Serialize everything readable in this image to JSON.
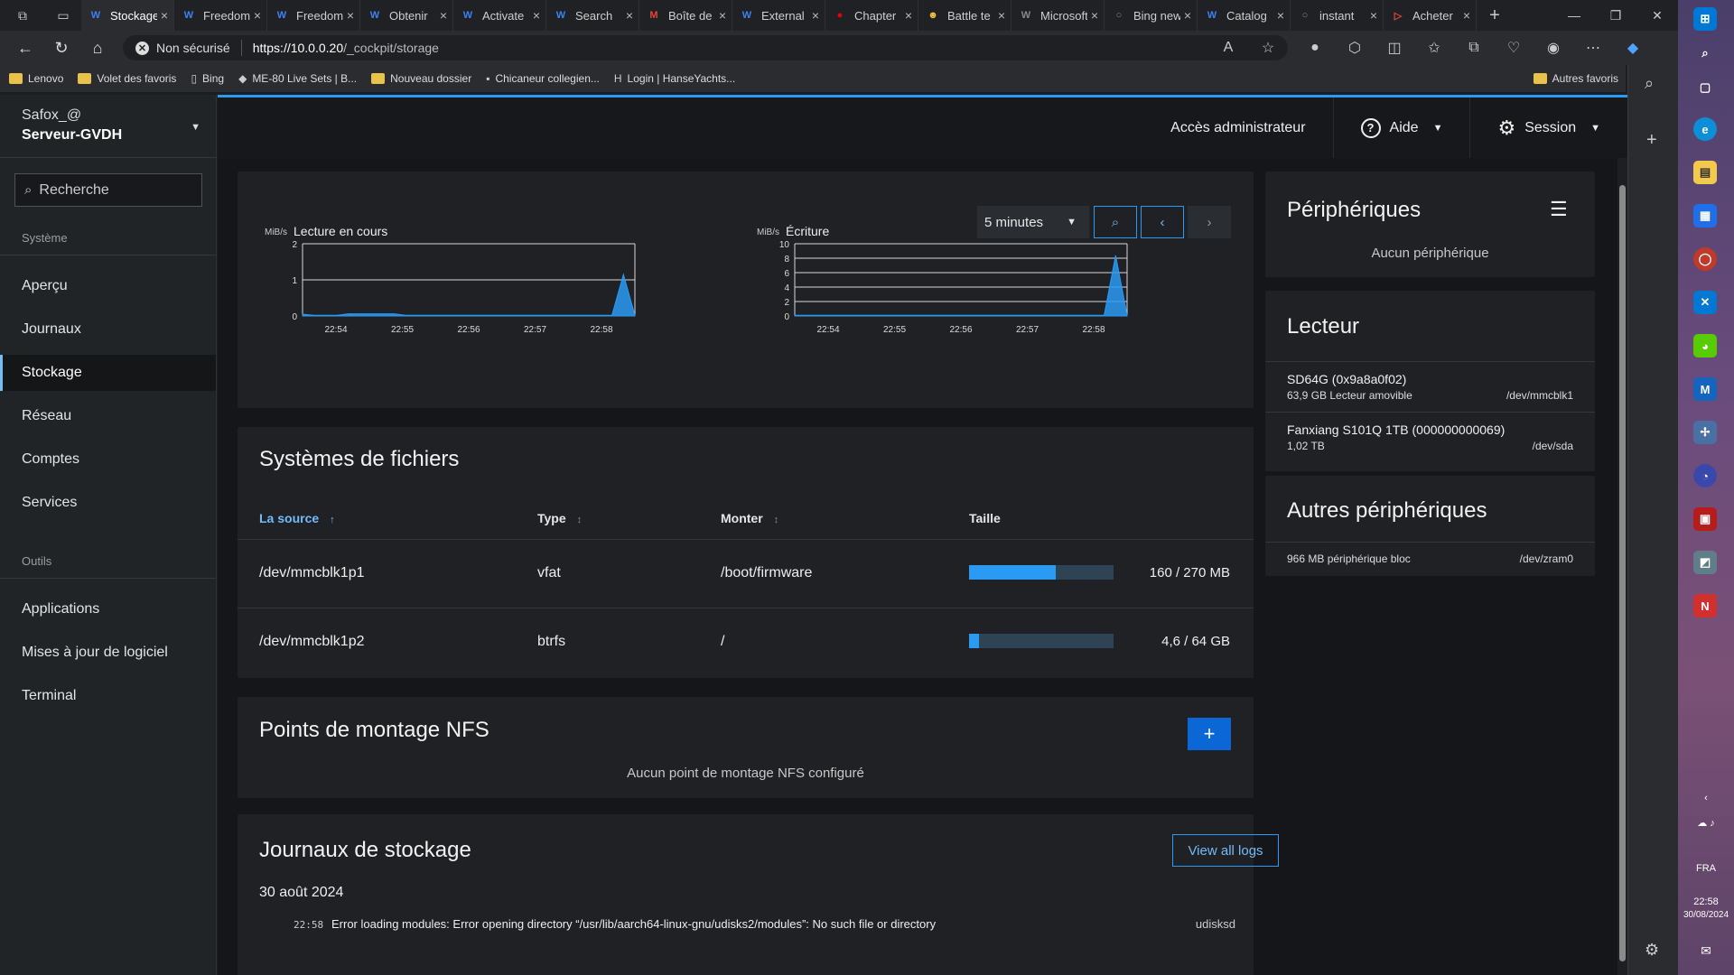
{
  "browser": {
    "tabs": [
      {
        "title": "Stockage",
        "icon": "cockpit-icon",
        "color": "#3b82f6",
        "active": true
      },
      {
        "title": "Freedom",
        "icon": "cockpit-icon",
        "color": "#3b82f6"
      },
      {
        "title": "Freedom",
        "icon": "cockpit-icon",
        "color": "#3b82f6"
      },
      {
        "title": "Obtenir",
        "icon": "cockpit-icon",
        "color": "#3b82f6"
      },
      {
        "title": "Activate",
        "icon": "cockpit-icon",
        "color": "#3b82f6"
      },
      {
        "title": "Search",
        "icon": "cockpit-icon",
        "color": "#3b82f6"
      },
      {
        "title": "Boîte de",
        "icon": "gmail-icon",
        "color": "#ea4335"
      },
      {
        "title": "External",
        "icon": "cockpit-icon",
        "color": "#3b82f6"
      },
      {
        "title": "Chapter",
        "icon": "redhat-icon",
        "color": "#e00"
      },
      {
        "title": "Battle te",
        "icon": "emoji-icon",
        "color": "#f5c542"
      },
      {
        "title": "Microsoft",
        "icon": "cockpit-icon",
        "color": "#888"
      },
      {
        "title": "Bing new",
        "icon": "search-icon",
        "color": "#888"
      },
      {
        "title": "Catalog",
        "icon": "cockpit-icon",
        "color": "#3b82f6"
      },
      {
        "title": "instant",
        "icon": "search-icon",
        "color": "#888"
      },
      {
        "title": "Acheter",
        "icon": "play-icon",
        "color": "#e74c3c"
      }
    ],
    "security_label": "Non sécurisé",
    "url_host": "https://10.0.0.20",
    "url_path": "/_cockpit/storage",
    "favorites": [
      {
        "label": "Lenovo",
        "icon": "folder-icon"
      },
      {
        "label": "Volet des favoris",
        "icon": "folder-icon"
      },
      {
        "label": "Bing",
        "icon": "page-icon"
      },
      {
        "label": "ME-80 Live Sets | B...",
        "icon": "diamond-icon"
      },
      {
        "label": "Nouveau dossier",
        "icon": "folder-icon"
      },
      {
        "label": "Chicaneur collegien...",
        "icon": "pf-icon"
      },
      {
        "label": "Login | HanseYachts...",
        "icon": "h-icon"
      }
    ],
    "other_favorites": "Autres favoris"
  },
  "sidebar": {
    "user": "Safox_@",
    "host": "Serveur-GVDH",
    "search_placeholder": "Recherche",
    "section_system": "Système",
    "system_items": [
      "Aperçu",
      "Journaux",
      "Stockage",
      "Réseau",
      "Comptes",
      "Services"
    ],
    "section_tools": "Outils",
    "tool_items": [
      "Applications",
      "Mises à jour de logiciel",
      "Terminal"
    ],
    "active": "Stockage"
  },
  "topbar": {
    "admin": "Accès administrateur",
    "help": "Aide",
    "session": "Session"
  },
  "charts": {
    "range": "5 minutes",
    "unit": "MiB/s"
  },
  "chart_data": [
    {
      "type": "area",
      "title": "Lecture en cours",
      "ylabel": "MiB/s",
      "ylim": [
        0,
        2
      ],
      "yticks": [
        "0",
        "1",
        "2"
      ],
      "xticks": [
        "22:54",
        "22:55",
        "22:56",
        "22:57",
        "22:58"
      ],
      "series": [
        {
          "values": [
            0.05,
            0.02,
            0.02,
            0.02,
            0.06,
            0.06,
            0.06,
            0.06,
            0.06,
            0.02,
            0.02,
            0.02,
            0.02,
            0.02,
            0.02,
            0.02,
            0.02,
            0.02,
            0.02,
            0.02,
            0.02,
            0.02,
            0.02,
            0.02,
            0.02,
            0.02,
            0.02,
            0.02,
            1.15,
            0.02
          ]
        }
      ]
    },
    {
      "type": "area",
      "title": "Écriture",
      "ylabel": "MiB/s",
      "ylim": [
        0,
        10
      ],
      "yticks": [
        "0",
        "2",
        "4",
        "6",
        "8",
        "10"
      ],
      "xticks": [
        "22:54",
        "22:55",
        "22:56",
        "22:57",
        "22:58"
      ],
      "series": [
        {
          "values": [
            0.1,
            0.1,
            0.1,
            0.1,
            0.1,
            0.1,
            0.1,
            0.1,
            0.1,
            0.1,
            0.1,
            0.1,
            0.1,
            0.1,
            0.1,
            0.1,
            0.1,
            0.1,
            0.1,
            0.1,
            0.1,
            0.1,
            0.1,
            0.1,
            0.1,
            0.1,
            0.1,
            0.1,
            8.4,
            0.1
          ]
        }
      ]
    }
  ],
  "filesystems": {
    "title": "Systèmes de fichiers",
    "headers": {
      "source": "La source",
      "type": "Type",
      "mount": "Monter",
      "size": "Taille"
    },
    "rows": [
      {
        "source": "/dev/mmcblk1p1",
        "type": "vfat",
        "mount": "/boot/firmware",
        "size": "160 / 270 MB",
        "usage": 0.6
      },
      {
        "source": "/dev/mmcblk1p2",
        "type": "btrfs",
        "mount": "/",
        "size": "4,6 / 64 GB",
        "usage": 0.07
      }
    ]
  },
  "nfs": {
    "title": "Points de montage NFS",
    "add": "+",
    "empty": "Aucun point de montage NFS configuré"
  },
  "logs": {
    "title": "Journaux de stockage",
    "view_all": "View all logs",
    "date": "30 août 2024",
    "entries": [
      {
        "time": "22:58",
        "message": "Error loading modules: Error opening directory “/usr/lib/aarch64-linux-gnu/udisks2/modules”: No such file or directory",
        "source": "udisksd"
      }
    ]
  },
  "devices": {
    "title": "Périphériques",
    "empty": "Aucun périphérique"
  },
  "drives": {
    "title": "Lecteur",
    "items": [
      {
        "name": "SD64G (0x9a8a0f02)",
        "detail": "63,9 GB Lecteur amovible",
        "path": "/dev/mmcblk1"
      },
      {
        "name": "Fanxiang S101Q 1TB (000000000069)",
        "detail": "1,02 TB",
        "path": "/dev/sda"
      }
    ]
  },
  "other_devices": {
    "title": "Autres périphériques",
    "items": [
      {
        "detail": "966 MB périphérique bloc",
        "path": "/dev/zram0"
      }
    ]
  },
  "taskbar": {
    "lang": "FRA",
    "time": "22:58",
    "date": "30/08/2024"
  }
}
